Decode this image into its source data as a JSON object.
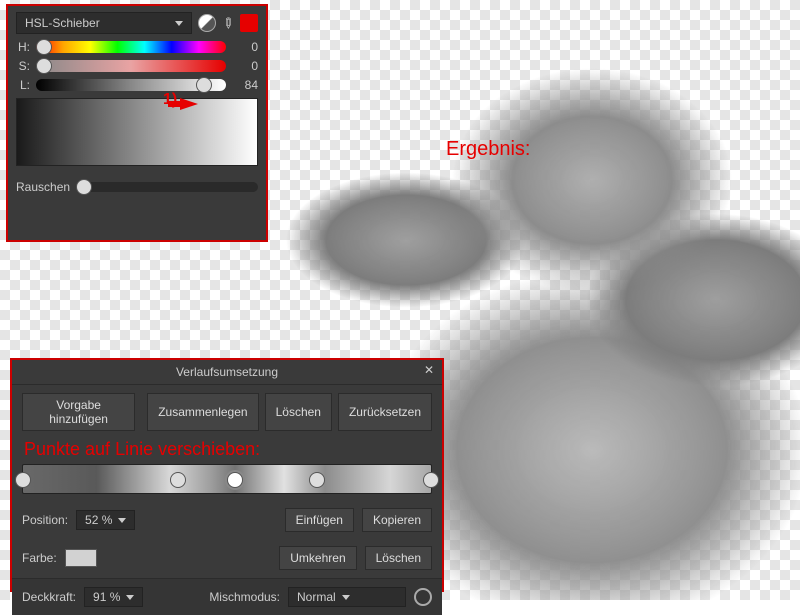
{
  "annotations": {
    "ergebnis": "Ergebnis:",
    "step1": "1)",
    "punkte": "Punkte auf Linie verschieben:"
  },
  "hsl_panel": {
    "mode": "HSL-Schieber",
    "rows": {
      "h": {
        "label": "H:",
        "value": "0",
        "thumb_pct": 0
      },
      "s": {
        "label": "S:",
        "value": "0",
        "thumb_pct": 0
      },
      "l": {
        "label": "L:",
        "value": "84",
        "thumb_pct": 84
      }
    },
    "noise_label": "Rauschen",
    "noise_thumb_pct": 0
  },
  "gradient_panel": {
    "title": "Verlaufsumsetzung",
    "buttons": {
      "add_preset": "Vorgabe hinzufügen",
      "merge": "Zusammenlegen",
      "delete": "Löschen",
      "reset": "Zurücksetzen",
      "insert": "Einfügen",
      "copy": "Kopieren",
      "reverse": "Umkehren",
      "delete2": "Löschen"
    },
    "stops_pct": [
      0,
      38,
      52,
      72,
      100
    ],
    "selected_stop_index": 2,
    "position": {
      "label": "Position:",
      "value": "52 %"
    },
    "color_label": "Farbe:",
    "opacity": {
      "label": "Deckkraft:",
      "value": "91 %"
    },
    "blend": {
      "label": "Mischmodus:",
      "value": "Normal"
    }
  }
}
